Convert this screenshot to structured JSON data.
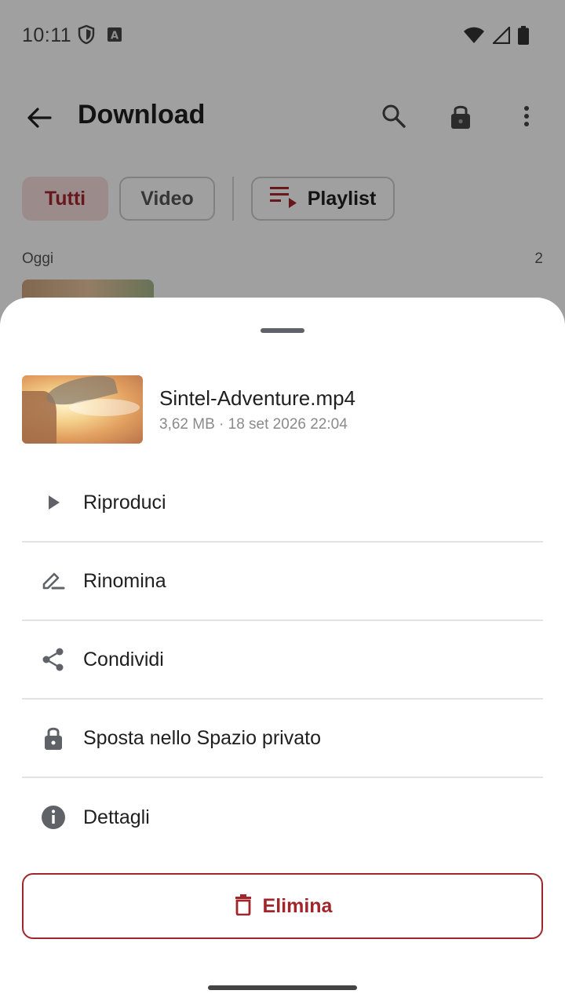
{
  "status_bar": {
    "time": "10:11",
    "icons": [
      "shield-icon",
      "accessibility-a-icon",
      "wifi-icon",
      "cell-signal-icon",
      "battery-icon"
    ]
  },
  "toolbar": {
    "title": "Download",
    "icons": [
      "back-arrow-icon",
      "search-icon",
      "lock-icon",
      "more-vert-icon"
    ]
  },
  "filters": {
    "all": "Tutti",
    "video": "Video",
    "playlist": "Playlist"
  },
  "section": {
    "label": "Oggi",
    "count": "2"
  },
  "sheet": {
    "file": {
      "name": "Sintel-Adventure.mp4",
      "meta": "3,62 MB · 18 set 2026 22:04"
    },
    "items": [
      {
        "label": "Riproduci",
        "icon": "play-icon"
      },
      {
        "label": "Rinomina",
        "icon": "rename-pencil-icon"
      },
      {
        "label": "Condividi",
        "icon": "share-icon"
      },
      {
        "label": "Sposta nello Spazio privato",
        "icon": "lock-icon"
      },
      {
        "label": "Dettagli",
        "icon": "info-icon"
      }
    ],
    "delete_label": "Elimina"
  },
  "colors": {
    "accent": "#a1262c",
    "chip_selected_bg": "#f3dcd9",
    "icon_gray": "#5f6368"
  }
}
